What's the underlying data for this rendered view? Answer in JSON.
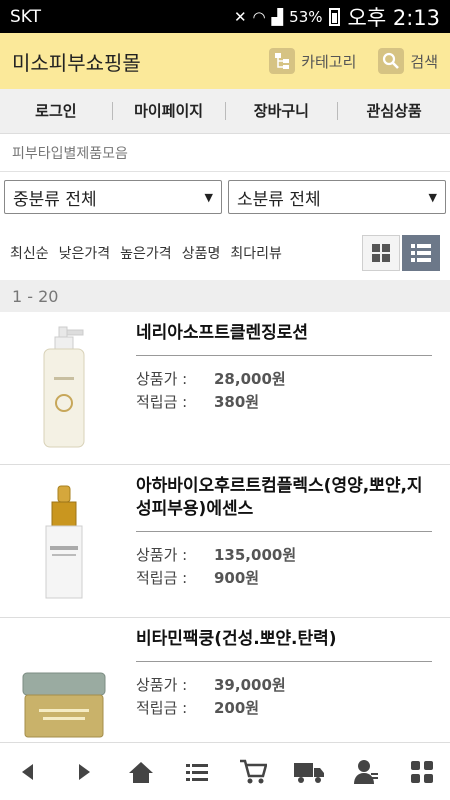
{
  "status": {
    "carrier": "SKT",
    "battery": "53%",
    "time": "오후 2:13"
  },
  "header": {
    "title": "미소피부쇼핑몰",
    "category_label": "카테고리",
    "search_label": "검색",
    "accent": "#fbe99a"
  },
  "topnav": [
    "로그인",
    "마이페이지",
    "장바구니",
    "관심상품"
  ],
  "section_title": "피부타입별제품모음",
  "filters": {
    "mid": "중분류 전체",
    "small": "소분류 전체"
  },
  "sorts": [
    "최신순",
    "낮은가격",
    "높은가격",
    "상품명",
    "최다리뷰"
  ],
  "range": "1 - 20",
  "labels": {
    "price": "상품가 :",
    "points": "적립금 :"
  },
  "products": [
    {
      "name": "네리아소프트클렌징로션",
      "price": "28,000원",
      "points": "380원"
    },
    {
      "name": "아하바이오후르트컴플렉스(영양,뽀얀,지성피부용)에센스",
      "price": "135,000원",
      "points": "900원"
    },
    {
      "name": "비타민팩쿵(건성.뽀얀.탄력)",
      "price": "39,000원",
      "points": "200원"
    }
  ],
  "bottomnav": [
    "back-icon",
    "forward-icon",
    "home-icon",
    "list-icon",
    "cart-icon",
    "truck-icon",
    "user-icon",
    "menu-grid-icon"
  ]
}
